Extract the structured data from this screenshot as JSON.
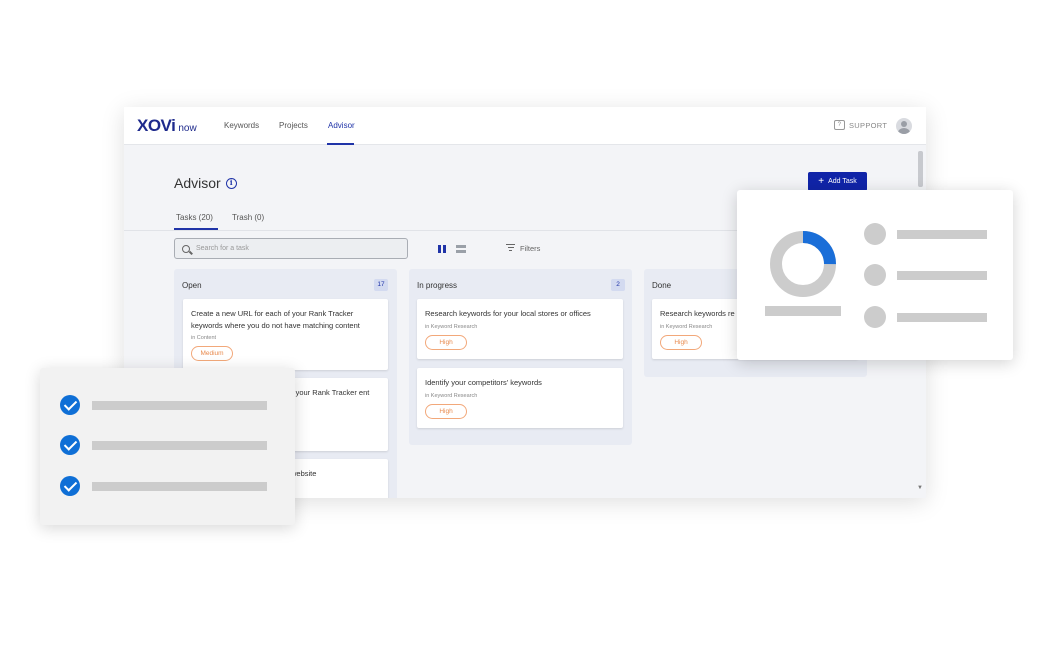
{
  "brand": {
    "logo_main": "XOVi",
    "logo_sub": "now",
    "accent": "#1024a8"
  },
  "nav": {
    "items": [
      {
        "label": "Keywords",
        "active": false
      },
      {
        "label": "Projects",
        "active": false
      },
      {
        "label": "Advisor",
        "active": true
      }
    ],
    "support_label": "SUPPORT",
    "support_icon": "help-chat-icon",
    "avatar_icon": "user-avatar-icon"
  },
  "page": {
    "title": "Advisor",
    "info_icon": "info-icon",
    "add_task_label": "Add Task"
  },
  "tabs": [
    {
      "label": "Tasks (20)",
      "active": true
    },
    {
      "label": "Trash (0)",
      "active": false
    }
  ],
  "toolbar": {
    "search_placeholder": "Search for a task",
    "filters_label": "Filters"
  },
  "columns": [
    {
      "title": "Open",
      "count": "17",
      "cards": [
        {
          "title": "Create a new URL for each of your Rank Tracker keywords where you do not have matching content",
          "category": "in Content",
          "priority": "Medium"
        },
        {
          "title": "r your Rank Tracker ent",
          "category": "",
          "priority": ""
        },
        {
          "title": "website",
          "category": "",
          "priority": ""
        }
      ]
    },
    {
      "title": "In progress",
      "count": "2",
      "cards": [
        {
          "title": "Research keywords for your local stores or offices",
          "category": "in Keyword Research",
          "priority": "High"
        },
        {
          "title": "Identify your competitors' keywords",
          "category": "in Keyword Research",
          "priority": "High"
        }
      ]
    },
    {
      "title": "Done",
      "count": "",
      "cards": [
        {
          "title": "Research keywords re",
          "category": "in Keyword Research",
          "priority": "High"
        }
      ]
    }
  ],
  "overlay_donut": {
    "highlight_fraction": 0.25,
    "highlight_color": "#1a6ed8",
    "base_color": "#cccccc"
  },
  "colors": {
    "check": "#0f6fd6",
    "priority_border": "#f2a87a",
    "priority_text": "#e88a4d"
  }
}
